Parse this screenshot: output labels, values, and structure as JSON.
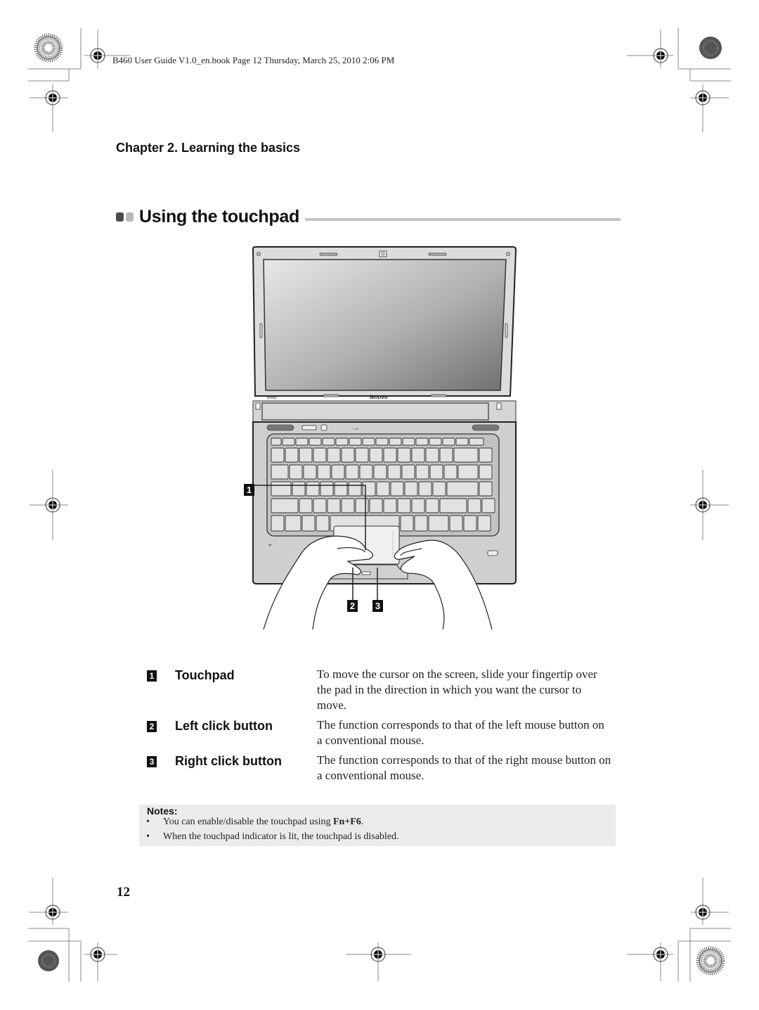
{
  "print_header": "B460 User Guide V1.0_en.book  Page 12  Thursday, March 25, 2010  2:06 PM",
  "chapter_title": "Chapter 2. Learning the basics",
  "section_title": "Using the touchpad",
  "figure": {
    "model_label": "B460",
    "brand_label": "lenovo",
    "callouts": [
      "1",
      "2",
      "3"
    ]
  },
  "items": [
    {
      "number": "1",
      "label": "Touchpad",
      "description": "To move the cursor on the screen, slide your fingertip over the pad in the direction in which you want the cursor to move."
    },
    {
      "number": "2",
      "label": "Left click button",
      "description": "The function corresponds to that of the left mouse button on a conventional mouse."
    },
    {
      "number": "3",
      "label": "Right click button",
      "description": "The function corresponds to that of the right mouse button on a conventional mouse."
    }
  ],
  "notes": {
    "title": "Notes:",
    "items": [
      {
        "bullet": "•",
        "text_before": "You can enable/disable the touchpad using ",
        "bold": "Fn+F6",
        "text_after": "."
      },
      {
        "bullet": "•",
        "text_before": "When the touchpad indicator is lit, the touchpad is disabled.",
        "bold": "",
        "text_after": ""
      }
    ]
  },
  "page_number": "12"
}
